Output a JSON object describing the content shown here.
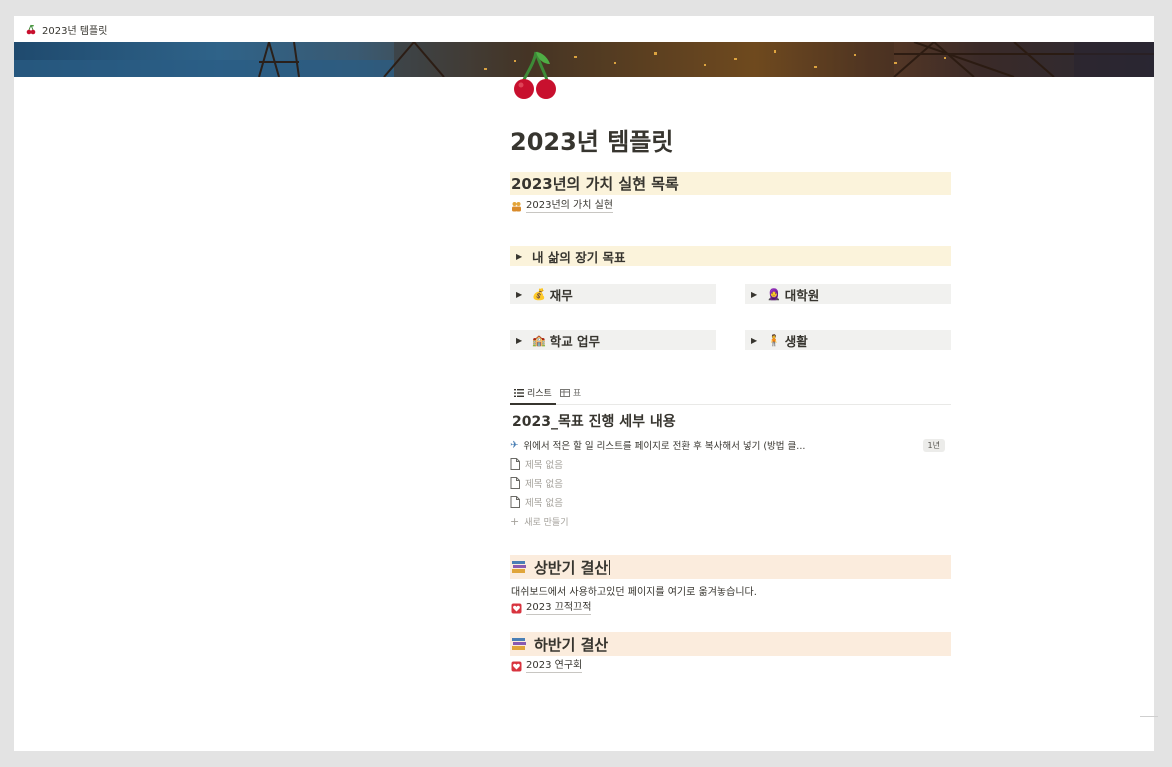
{
  "breadcrumb": {
    "icon": "cherry-icon",
    "title": "2023년 템플릿"
  },
  "page": {
    "icon": "cherry-icon",
    "title": "2023년 템플릿"
  },
  "values_section": {
    "heading": "2023년의 가치 실현 목록",
    "link": {
      "icon": "people-icon",
      "label": "2023년의 가치 실현"
    }
  },
  "toggles": {
    "long_term": {
      "emoji": "",
      "label": "내 삶의 장기 목표"
    },
    "finance": {
      "emoji": "💰",
      "label": "재무"
    },
    "grad_school": {
      "emoji": "🧕",
      "label": "대학원"
    },
    "school_work": {
      "emoji": "🏫",
      "label": "학교 업무"
    },
    "life": {
      "emoji": "🧍",
      "label": "생활"
    }
  },
  "database": {
    "tabs": [
      {
        "icon": "list-icon",
        "label": "리스트"
      },
      {
        "icon": "table-icon",
        "label": "표"
      }
    ],
    "title": "2023_목표 진행 세부 내용",
    "rows": [
      {
        "icon": "airplane-icon",
        "title": "위에서 적은 할 일 리스트를 페이지로 전환 후 복사해서 넣기 (방법 클...",
        "badge": "1년"
      },
      {
        "icon": "page-icon",
        "title": "제목 없음"
      },
      {
        "icon": "page-icon",
        "title": "제목 없음"
      },
      {
        "icon": "page-icon",
        "title": "제목 없음"
      }
    ],
    "new_label": "새로 만들기"
  },
  "first_half": {
    "heading": "상반기 결산",
    "description": "대쉬보드에서 사용하고있던 페이지를 여기로 옮겨놓습니다.",
    "link": {
      "icon": "heart-icon",
      "label": "2023 끄적끄적"
    }
  },
  "second_half": {
    "heading": "하반기 결산",
    "link": {
      "icon": "heart-icon",
      "label": "2023 연구회"
    }
  },
  "colors": {
    "yellow_bg": "#fbf3db",
    "orange_bg": "#fbecdd",
    "gray_bg": "#f1f1ef",
    "text": "#37352f"
  }
}
